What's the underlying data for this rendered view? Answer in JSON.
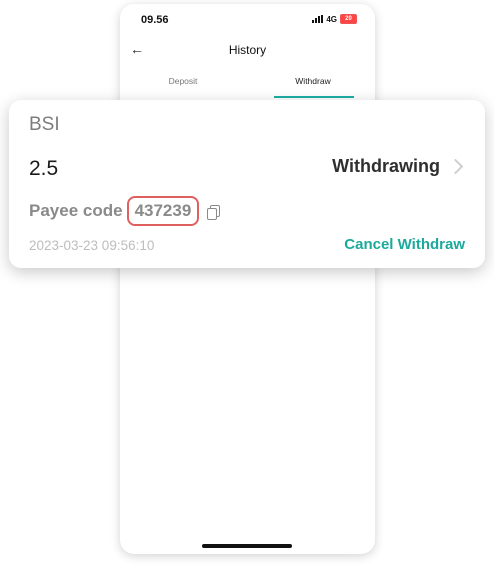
{
  "status_bar": {
    "time": "09.56",
    "network": "4G",
    "battery": "20"
  },
  "header": {
    "title": "History",
    "back_icon": "arrow-left-icon"
  },
  "tabs": [
    {
      "label": "Deposit"
    },
    {
      "label": "Withdraw",
      "active": true
    }
  ],
  "card": {
    "bank": "BSI",
    "amount": "2.5",
    "status": "Withdrawing",
    "payee_label": "Payee code",
    "payee_code": "437239",
    "date": "2023-03-23 09:56:10",
    "cancel_label": "Cancel Withdraw"
  },
  "colors": {
    "accent": "#1ba99c",
    "highlight": "#e06060"
  }
}
